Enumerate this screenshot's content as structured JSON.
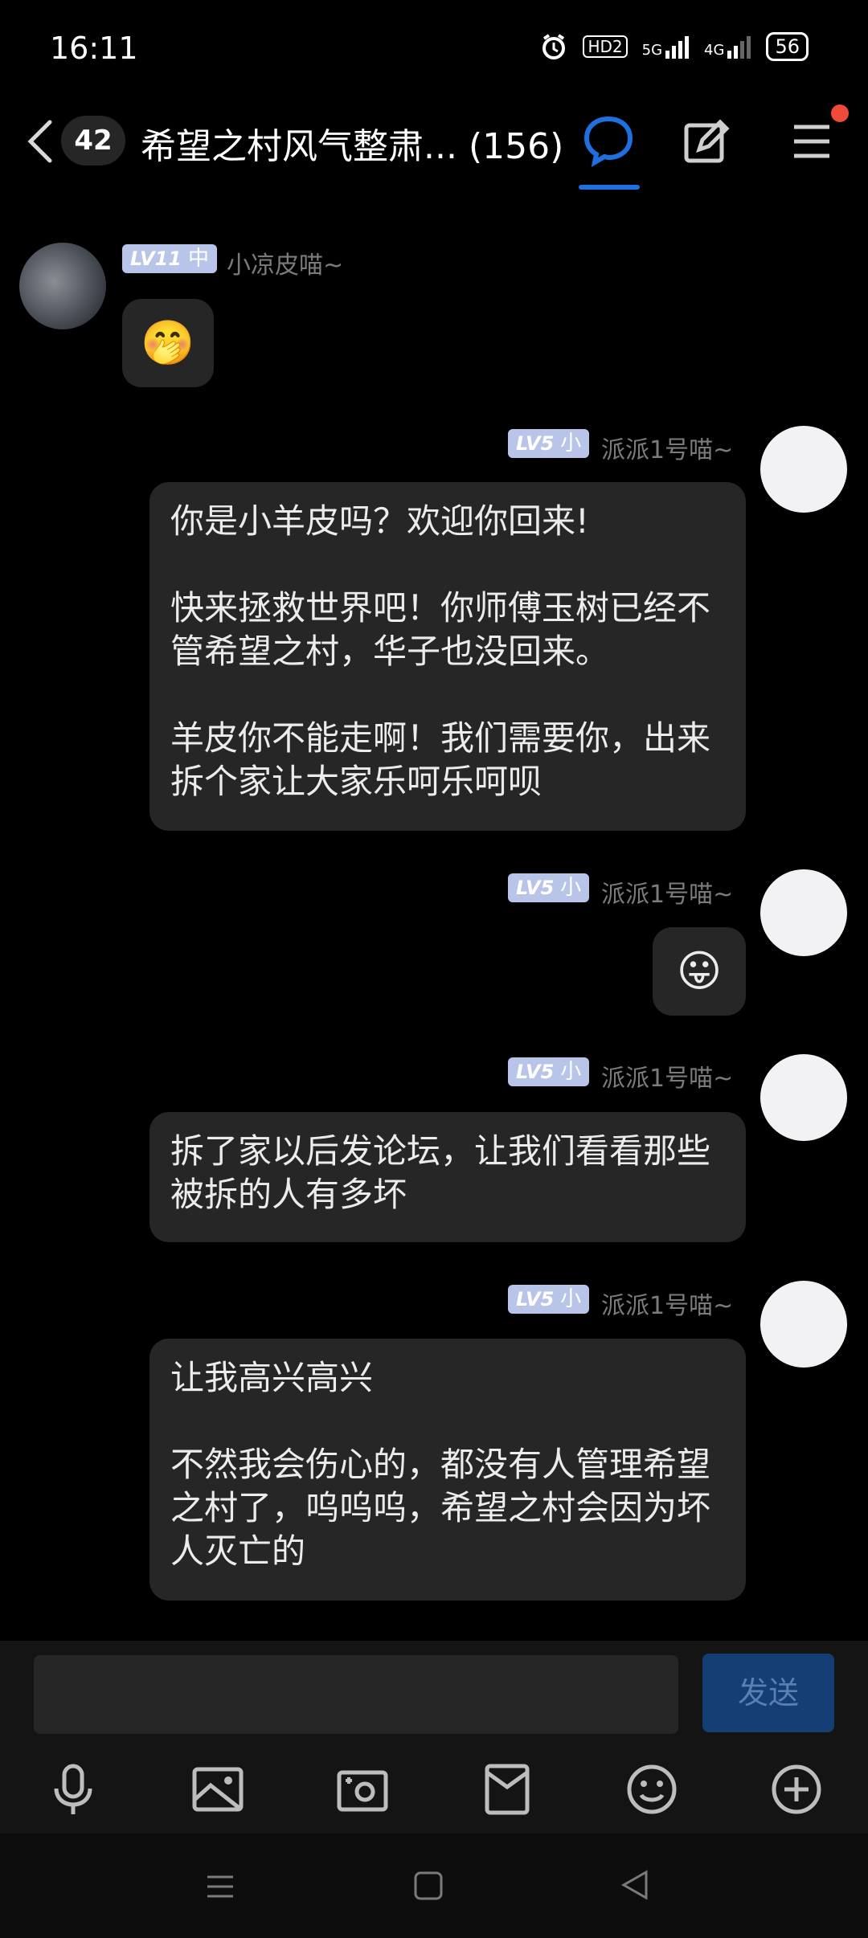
{
  "status_bar": {
    "time": "16:11",
    "hd_label": "HD2",
    "net1": "5G",
    "net2": "4G",
    "battery": "56"
  },
  "header": {
    "unread_count": "42",
    "title": "希望之村风气整肃... (156)"
  },
  "messages": [
    {
      "sender": "小凉皮喵~",
      "level": "LV11",
      "level_tag": "中",
      "side": "left",
      "emoji": "🤭"
    },
    {
      "sender": "派派1号喵~",
      "level": "LV5",
      "level_tag": "小",
      "side": "right",
      "paragraphs": [
        "你是小羊皮吗？欢迎你回来!",
        "快来拯救世界吧！你师傅玉树已经不管希望之村，华子也没回来。",
        "羊皮你不能走啊！我们需要你，出来拆个家让大家乐呵乐呵呗"
      ]
    },
    {
      "sender": "派派1号喵~",
      "level": "LV5",
      "level_tag": "小",
      "side": "right",
      "emoji": "😛"
    },
    {
      "sender": "派派1号喵~",
      "level": "LV5",
      "level_tag": "小",
      "side": "right",
      "paragraphs": [
        "拆了家以后发论坛，让我们看看那些被拆的人有多坏"
      ]
    },
    {
      "sender": "派派1号喵~",
      "level": "LV5",
      "level_tag": "小",
      "side": "right",
      "paragraphs": [
        "让我高兴高兴",
        "不然我会伤心的，都没有人管理希望之村了，呜呜呜，希望之村会因为坏人灭亡的"
      ]
    }
  ],
  "composer": {
    "placeholder": "",
    "send_label": "发送"
  },
  "toolbar_icons": [
    "microphone-icon",
    "image-icon",
    "camera-icon",
    "red-envelope-icon",
    "emoji-icon",
    "plus-icon"
  ],
  "colors": {
    "accent": "#1e6fe0",
    "bubble": "#262626",
    "level_badge": "#b8c4e8",
    "send_bg": "#153e74"
  }
}
